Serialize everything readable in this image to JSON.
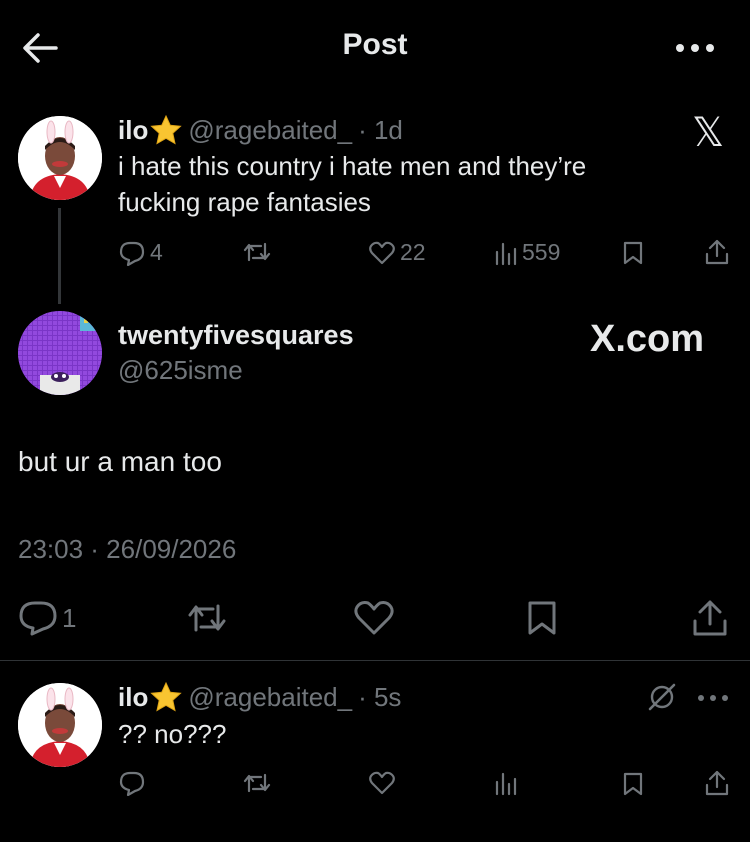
{
  "header": {
    "title": "Post"
  },
  "parent_tweet": {
    "display_name": "ilo",
    "handle": "@ragebaited_",
    "time": "· 1d",
    "text_line1": "i hate this country i hate men and they’re",
    "text_line2": "fucking rape fantasies",
    "replies": "4",
    "likes": "22",
    "views": "559",
    "source_watermark": "𝕏"
  },
  "main_tweet": {
    "display_name": "twentyfivesquares",
    "handle": "@625isme",
    "watermark": "X.com",
    "text": "but ur a man too",
    "timestamp": "23:03 · 26/09/2026",
    "replies": "1"
  },
  "reply_tweet": {
    "display_name": "ilo",
    "handle": "@ragebaited_",
    "time": "· 5s",
    "text": "?? no???"
  },
  "colors": {
    "background": "#000000",
    "text": "#e7e9ea",
    "muted": "#71767b",
    "divider": "#2f3336"
  }
}
